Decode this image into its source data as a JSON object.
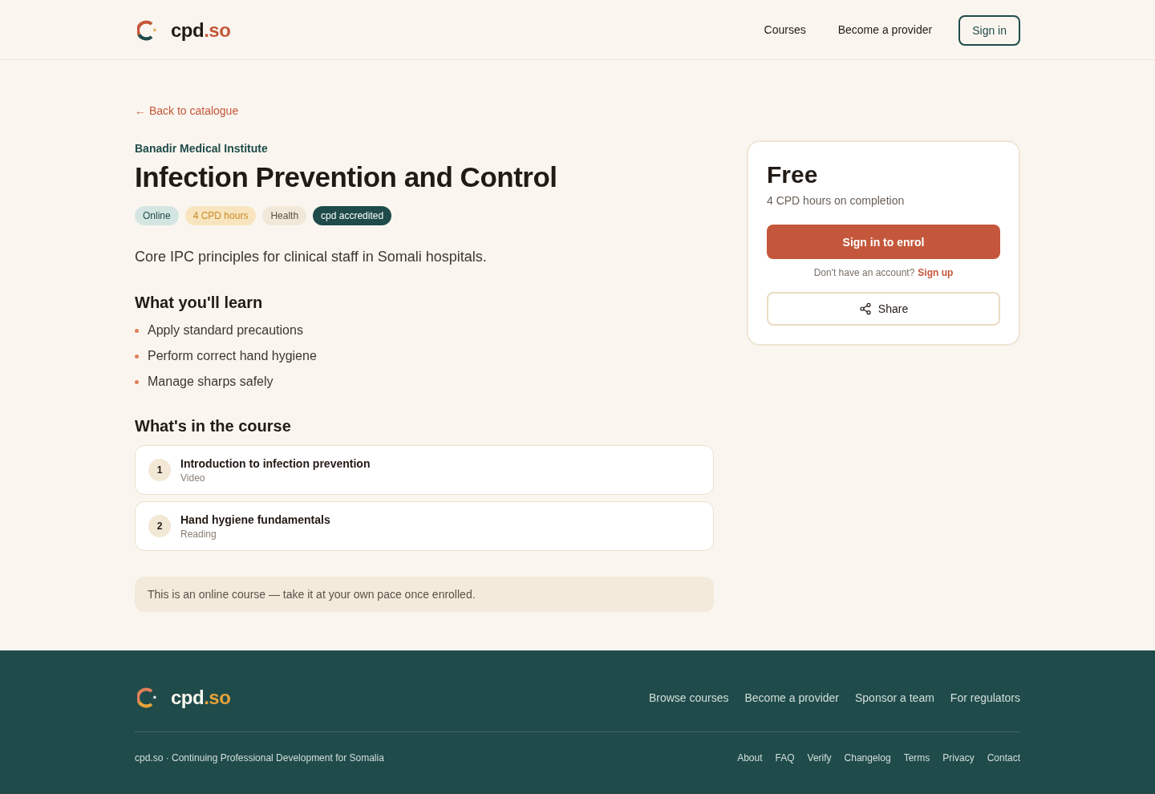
{
  "header": {
    "brand": {
      "name": "cpd",
      "suffix": ".so"
    },
    "nav": [
      "Courses",
      "Become a provider"
    ],
    "sign_in": "Sign in"
  },
  "back_link": "← Back to catalogue",
  "course": {
    "provider": "Banadir Medical Institute",
    "title": "Infection Prevention and Control",
    "tags": [
      {
        "label": "Online",
        "kind": "format"
      },
      {
        "label": "4 CPD hours",
        "kind": "hours"
      },
      {
        "label": "Health",
        "kind": "topic"
      },
      {
        "label": "cpd accredited",
        "kind": "accreditation"
      }
    ],
    "description": "Core IPC principles for clinical staff in Somali hospitals."
  },
  "learn": {
    "heading": "What you'll learn",
    "items": [
      "Apply standard precautions",
      "Perform correct hand hygiene",
      "Manage sharps safely"
    ]
  },
  "contents": {
    "heading": "What's in the course",
    "modules": [
      {
        "number": "1",
        "title": "Introduction to infection prevention",
        "type": "Video"
      },
      {
        "number": "2",
        "title": "Hand hygiene fundamentals",
        "type": "Reading"
      }
    ]
  },
  "notice": "This is an online course — take it at your own pace once enrolled.",
  "enrol_card": {
    "price": "Free",
    "subtitle": "4 CPD hours on completion",
    "primary_button": "Sign in to enrol",
    "signup_prompt": "Don't have an account?",
    "signup_link": "Sign up",
    "share_button": "Share"
  },
  "footer": {
    "brand": {
      "name": "cpd",
      "suffix": ".so"
    },
    "links": [
      "Browse courses",
      "Become a provider",
      "Sponsor a team",
      "For regulators"
    ],
    "tagline": "cpd.so · Continuing Professional Development for Somalia",
    "legal_links": [
      "About",
      "FAQ",
      "Verify",
      "Changelog",
      "Terms",
      "Privacy",
      "Contact"
    ]
  }
}
